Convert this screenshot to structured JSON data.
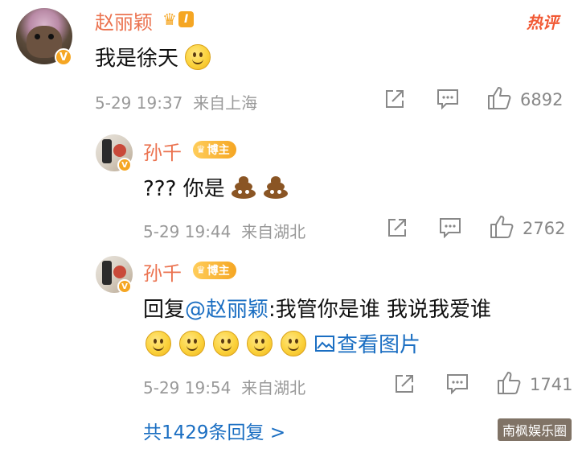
{
  "comments": [
    {
      "username": "赵丽颖",
      "level": "I",
      "hot_label": "热评",
      "text": "我是徐天",
      "date": "5-29 19:37",
      "location": "来自上海",
      "likes": "6892",
      "icons": [
        "share-icon",
        "comment-icon",
        "thumbs-up-icon"
      ]
    },
    {
      "username": "孙千",
      "badge": "博主",
      "text": "??? 你是",
      "date": "5-29 19:44",
      "location": "来自湖北",
      "likes": "2762"
    },
    {
      "username": "孙千",
      "badge": "博主",
      "reply_prefix": "回复",
      "mention": "@赵丽颖",
      "text": ":我管你是谁 我说我爱谁",
      "view_image_label": "查看图片",
      "date": "5-29 19:54",
      "location": "来自湖北",
      "likes": "1741"
    }
  ],
  "more_replies_label": "共1429条回复 >",
  "watermark": "南枫娱乐圈",
  "colors": {
    "username": "#eb7350",
    "link": "#1a6ec2",
    "badge": "#f5a623",
    "meta": "#999999"
  }
}
